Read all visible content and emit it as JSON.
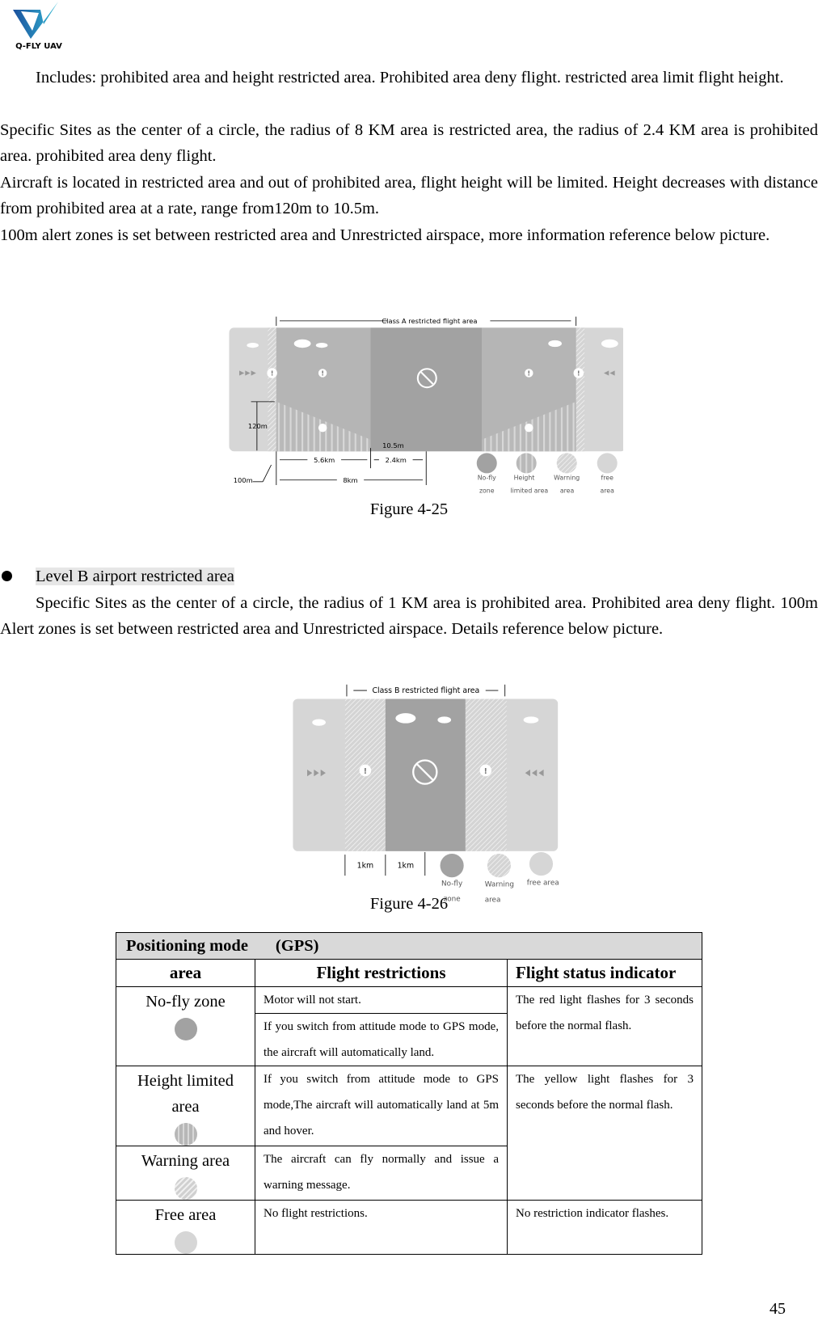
{
  "logo": {
    "text": "Q-FLY UAV",
    "colors": [
      "#1b4f9c",
      "#2fb3d1"
    ]
  },
  "paragraphs": [
    "Includes: prohibited area and height restricted area. Prohibited area deny flight. restricted area limit flight height.",
    "Specific Sites as the center of a circle, the radius of 8 KM area is restricted area, the radius of 2.4 KM area is prohibited area. prohibited area deny flight.",
    "Aircraft is located in restricted area and out of prohibited area, flight height will be limited. Height decreases with distance from prohibited area at a rate, range from120m to 10.5m.",
    "100m alert zones is set between restricted area and Unrestricted airspace, more information reference below picture."
  ],
  "figure_a": {
    "title": "Class A restricted flight area",
    "height_max": "120m",
    "height_min": "10.5m",
    "dist_restricted": "5.6km",
    "dist_prohibited": "2.4km",
    "dist_total": "8km",
    "dist_alert": "100m",
    "legend": [
      {
        "line1": "No-fly",
        "line2": "zone"
      },
      {
        "line1": "Height",
        "line2": "limited area"
      },
      {
        "line1": "Warning",
        "line2": "area"
      },
      {
        "line1": "free",
        "line2": "area"
      }
    ],
    "caption": "Figure 4-25"
  },
  "section_b": {
    "heading": "Level B airport restricted area",
    "text": "Specific Sites as the center of a circle, the radius of 1 KM area is prohibited area. Prohibited area deny flight. 100m Alert zones is set between restricted area and Unrestricted airspace. Details reference below picture."
  },
  "figure_b": {
    "title": "Class B restricted flight area",
    "dist1": "1km",
    "dist2": "1km",
    "legend": [
      {
        "line1": "No-fly",
        "line2": "zone"
      },
      {
        "line1": "Warning",
        "line2": "area"
      },
      {
        "line1": "free area",
        "line2": ""
      }
    ],
    "caption": "Figure 4-26"
  },
  "colors": {
    "nofly": "#a2a2a2",
    "height_limited": "#b7b7b7",
    "warning": "#d0d0d0",
    "free": "#d6d6d6"
  },
  "table": {
    "mode_label": "Positioning mode",
    "mode_value": "(GPS)",
    "headers": [
      "area",
      "Flight restrictions",
      "Flight status indicator"
    ],
    "rows": [
      {
        "area": "No-fly zone",
        "restrictions": [
          "Motor will not start.",
          "If you switch from attitude mode to GPS mode, the aircraft will automatically land."
        ],
        "indicator": "The red light flashes for 3 seconds before the normal flash."
      },
      {
        "area": "Height limited area",
        "restrictions": [
          "If you switch from attitude mode to GPS mode,The aircraft will automatically land at 5m and hover."
        ],
        "indicator": "The yellow light flashes for 3 seconds before the normal flash."
      },
      {
        "area": "Warning area",
        "restrictions": [
          "The aircraft can fly normally and issue a warning message."
        ]
      },
      {
        "area": "Free area",
        "restrictions": [
          "No flight restrictions."
        ],
        "indicator": "No restriction indicator flashes."
      }
    ]
  },
  "page_number": "45"
}
